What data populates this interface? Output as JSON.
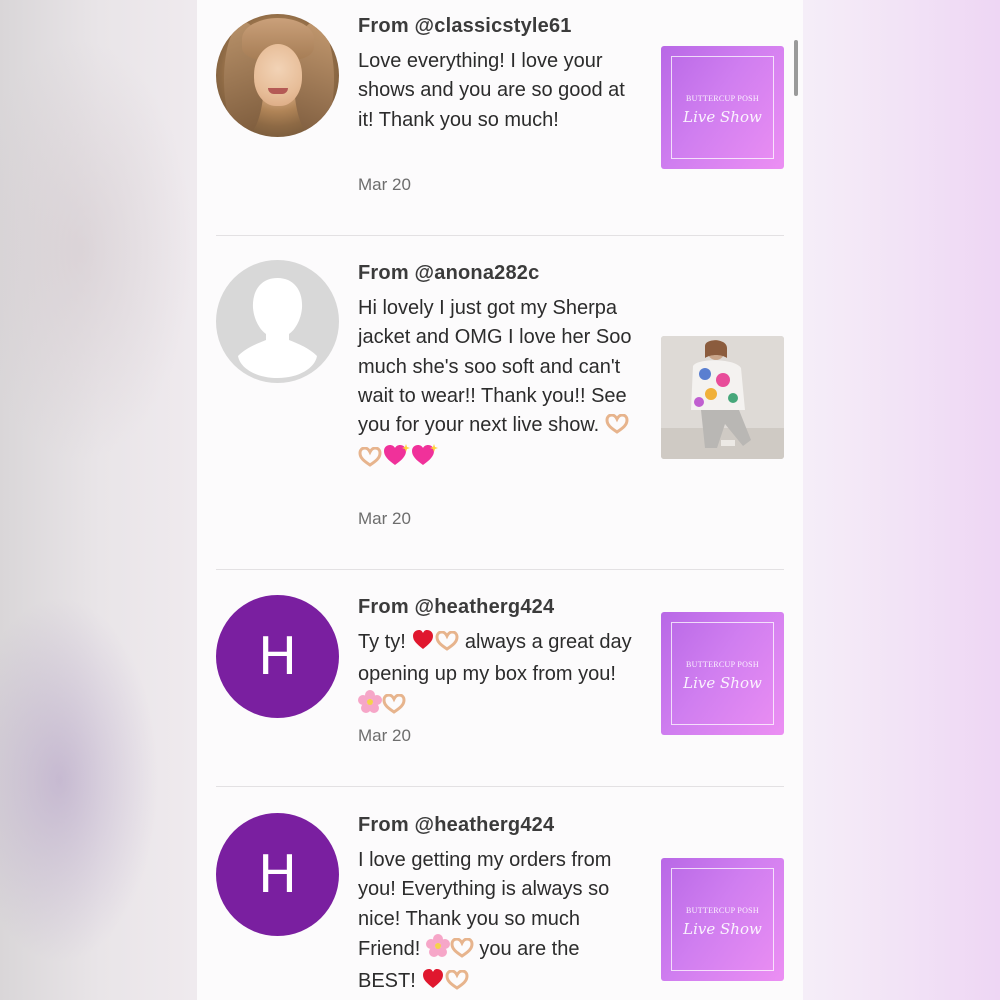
{
  "colors": {
    "avatar_letter_bg": "#7a1fa0",
    "brand_thumb_start": "#b868e6",
    "brand_thumb_end": "#ec8ff3"
  },
  "brand_thumb": {
    "line1": "BUTTERCUP POSH",
    "line2": "Live Show"
  },
  "messages": [
    {
      "from": "From @classicstyle61",
      "avatar": "user-photo",
      "body": "Love everything! I love your shows and you are so good at it! Thank you so much!",
      "date": "Mar 20",
      "thumbnail": "brand"
    },
    {
      "from": "From @anona282c",
      "avatar": "default-silhouette",
      "body": "Hi lovely I just got my Sherpa jacket and OMG I love her Soo much she's soo soft and can't wait to wear!! Thank you!! See you for your next live show.",
      "emoji_suffix": [
        "heart-hands",
        "heart-hands",
        "sparkling-heart",
        "sparkling-heart"
      ],
      "date": "Mar 20",
      "thumbnail": "product-photo"
    },
    {
      "from": "From @heatherg424",
      "avatar": "letter",
      "avatar_letter": "H",
      "body_parts": [
        "Ty ty! ",
        " always a great day opening up my box from you! "
      ],
      "date": "Mar 20",
      "thumbnail": "brand"
    },
    {
      "from": "From @heatherg424",
      "avatar": "letter",
      "avatar_letter": "H",
      "body_parts": [
        "I love getting my orders from you! Everything is always so nice! Thank you so much Friend! ",
        " you are the BEST! "
      ],
      "date": "",
      "thumbnail": "brand"
    }
  ]
}
